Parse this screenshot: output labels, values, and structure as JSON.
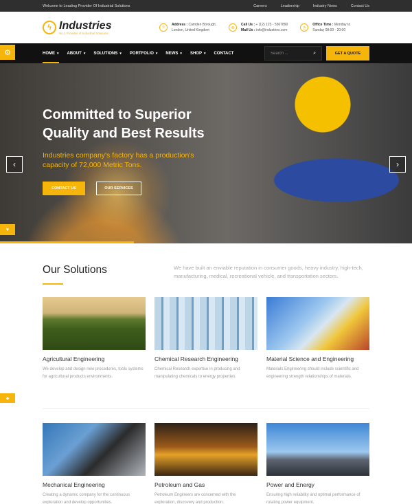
{
  "topbar": {
    "welcome": "Welcome to Leading Provider Of Industrial Solutions",
    "links": [
      "Careers",
      "Leadership",
      "Industry News",
      "Contact Us"
    ]
  },
  "header": {
    "logo_name": "Industries",
    "logo_tag": "No.1 Provider of Industrial Solutions",
    "address_label": "Address :",
    "address_line1": "Camden Borough,",
    "address_line2": "London, United Kingdom",
    "call_label": "Call Us :",
    "call_value": "+ (12) 123 - 5567890",
    "mail_label": "Mail Us :",
    "mail_value": "info@industries.com",
    "office_label": "Office Time :",
    "office_line1": "Monday to",
    "office_line2": "Sunday 08:00 - 20:00"
  },
  "nav": {
    "items": [
      {
        "label": "HOME",
        "dropdown": true
      },
      {
        "label": "ABOUT",
        "dropdown": true
      },
      {
        "label": "SOLUTIONS",
        "dropdown": true
      },
      {
        "label": "PORTFOLIO",
        "dropdown": true
      },
      {
        "label": "NEWS",
        "dropdown": true
      },
      {
        "label": "SHOP",
        "dropdown": true
      },
      {
        "label": "CONTACT",
        "dropdown": false
      }
    ],
    "search_placeholder": "Search ...",
    "quote_button": "GET A QUOTE"
  },
  "hero": {
    "title_line1": "Committed to Superior",
    "title_line2": "Quality and Best Results",
    "subtitle_line1": "Industries company's factory has a production's",
    "subtitle_line2": "capacity of 72,000 Metric Tons.",
    "contact_button": "CONTACT US",
    "services_button": "OUR SERVICES"
  },
  "solutions": {
    "title": "Our Solutions",
    "description": "We have built an enviable reputation in consumer goods, heavy industry, high-tech, manufacturing, medical, recreational vehicle, and transportation sectors.",
    "cards": [
      {
        "title": "Agricultural Engineering",
        "text": "We develop and design new procedures, tools systems for agricultural products environments."
      },
      {
        "title": "Chemical Research Engineering",
        "text": "Chemical Research expertise in producing and manipulating chemicals to energy properties."
      },
      {
        "title": "Material Science and Engineering",
        "text": "Materials Engineering should include scientific and engineering strength relationships of materials."
      },
      {
        "title": "Mechanical Engineering",
        "text": "Creating a dynamic company for the continuous exploration and develop opportunities."
      },
      {
        "title": "Petroleum and Gas",
        "text": "Petroleum Engineers are concerned with the exploration, discovery and production."
      },
      {
        "title": "Power and Energy",
        "text": "Ensuring high reliability and optimal performance of rotating power equipment."
      }
    ]
  },
  "colors": {
    "accent": "#f5b50a",
    "nav_bg": "#111111",
    "topbar_bg": "#2f2f2f"
  }
}
